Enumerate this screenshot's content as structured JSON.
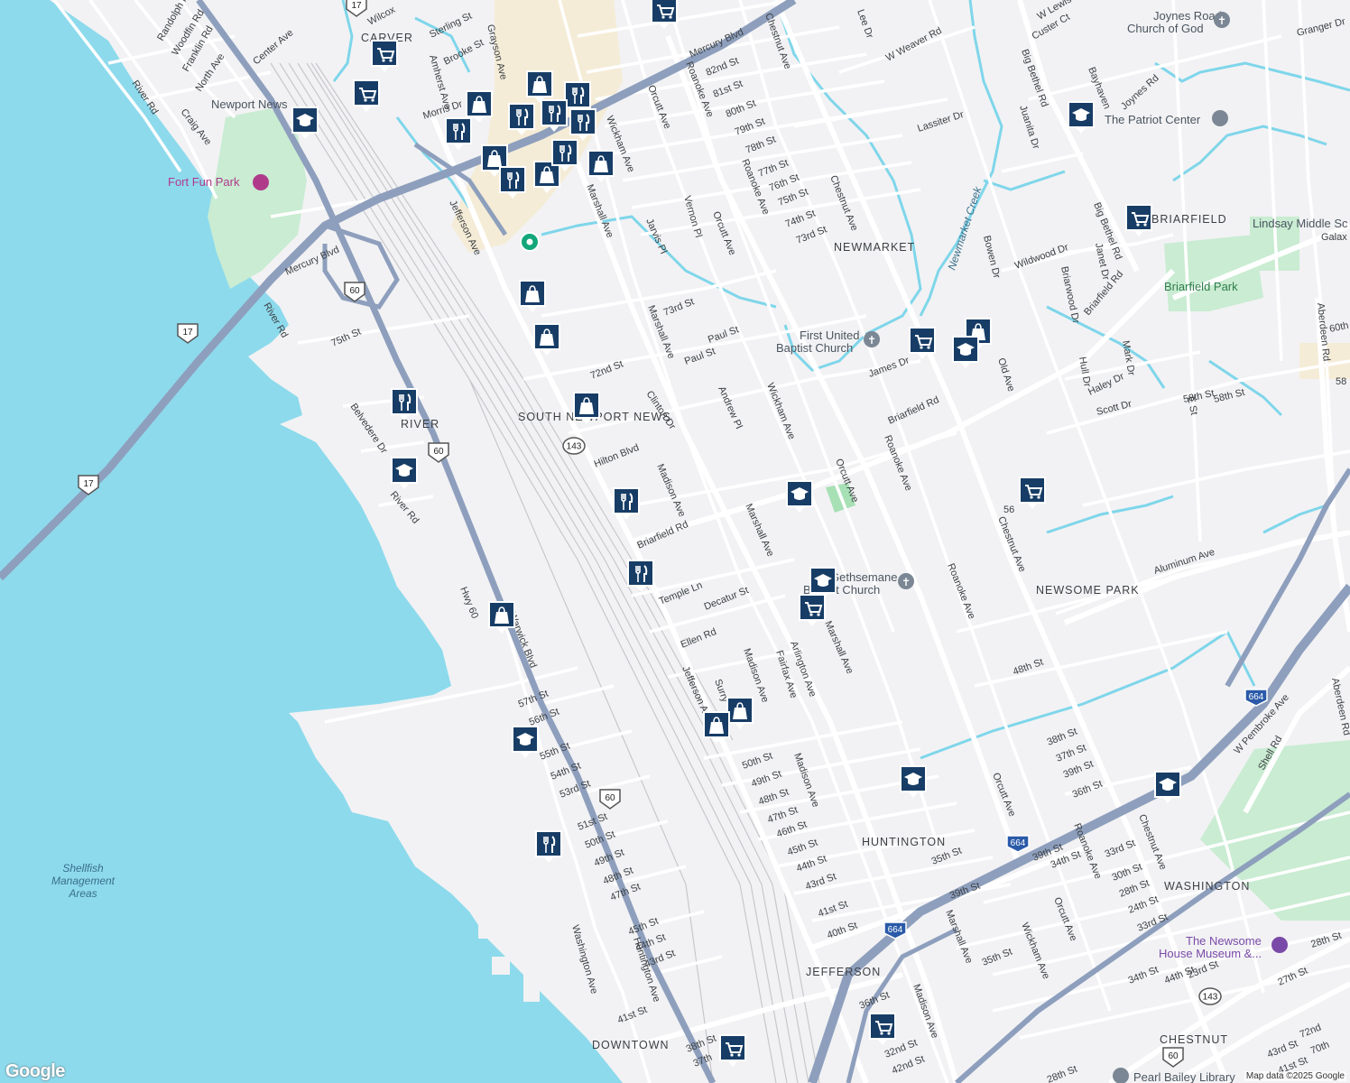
{
  "map": {
    "colors": {
      "water": "#8ddaec",
      "land": "#f2f2f4",
      "road": "#ffffff",
      "highway": "#8e9fbd",
      "park": "#c9ecd2",
      "commercial": "#f5ecd7",
      "creek": "#7fd6ea",
      "rail": "#c8c8cc",
      "pin": "#173d66"
    },
    "neighborhoods": [
      "CARVER",
      "NEWMARKET",
      "BRIARFIELD",
      "NEWSOME PARK",
      "HUNTINGTON",
      "WASHINGTON",
      "JEFFERSON",
      "DOWNTOWN",
      "CHESTNUT",
      "SOUTH NEWPORT NEWS",
      "RIVER"
    ],
    "water_labels": [
      "Shellfish",
      "Management",
      "Areas",
      "Newmarket Creek"
    ],
    "pois": [
      "Newport News",
      "Fort Fun Park",
      "First United",
      "Baptist Church",
      "Gethsemane",
      "Baptist Church",
      "Joynes Road",
      "Church of God",
      "The Patriot Center",
      "Lindsay Middle Sc",
      "Briarfield Park",
      "The Newsome",
      "House Museum &...",
      "Pearl Bailey Library",
      "Galax St"
    ],
    "streets": [
      "Mercury Blvd",
      "Jefferson Ave",
      "Marshall Ave",
      "Roanoke Ave",
      "Chestnut Ave",
      "Wickham Ave",
      "Orcutt Ave",
      "Big Bethel Rd",
      "Briarfield Rd",
      "Huntington Ave",
      "Warwick Blvd",
      "Hwy 60",
      "River Rd",
      "Aluminum Ave",
      "W Pembroke Ave",
      "Aberdeen Rd",
      "39th St",
      "28th St",
      "27th St",
      "48th St",
      "58th St",
      "72nd St",
      "73rd St",
      "75th St",
      "Hilton Blvd",
      "Clinton Dr",
      "Madison Ave",
      "Andrew Pl",
      "Paul St",
      "Temple Ln",
      "Decatur St",
      "Ellen Rd",
      "Arlington Ave",
      "Fairfax Ave",
      "Jarvis Pl",
      "Vernon Pl",
      "Lassiter Dr",
      "W Weaver Rd",
      "Joynes Rd",
      "Custer Ct",
      "Bayhaven",
      "Juanita Dr",
      "Wildwood Dr",
      "Briarwood Dr",
      "Janet Dr",
      "Bowen Dr",
      "Mark Dr",
      "Haley Dr",
      "Scott Dr",
      "Hull Dr",
      "Old Ave",
      "James Dr",
      "E St",
      "Shell Rd",
      "Washington Ave",
      "Belvedere Dr",
      "Center Ave",
      "North Ave",
      "Franklin Rd",
      "Woodfin Rd",
      "Randolph Rd",
      "Craig Ave",
      "River Rd",
      "Sterling St",
      "Brooke St",
      "Grayson Ave",
      "Amherst Ave",
      "Morris Dr",
      "Wilcox",
      "Granger Dr",
      "W Lewis Rd",
      "Lee Dr",
      "Surry"
    ],
    "numbered_streets": [
      "82nd St",
      "81st St",
      "80th St",
      "79th St",
      "78th St",
      "77th St",
      "76th St",
      "75th St",
      "74th St",
      "73rd St",
      "60th",
      "58th St",
      "58",
      "56",
      "50th St",
      "49th St",
      "48th St",
      "47th St",
      "46th St",
      "45th St",
      "44th St",
      "43rd St",
      "41st St",
      "40th St",
      "57th St",
      "56th St",
      "55th St",
      "54th St",
      "53rd St",
      "51st St",
      "50th St",
      "49th St",
      "48th St",
      "47th St",
      "45th St",
      "44th St",
      "43rd St",
      "41st St",
      "38th St",
      "37th",
      "36th St",
      "35th St",
      "34th St",
      "33rd St",
      "32nd St",
      "42nd St",
      "44th St",
      "43rd St",
      "41st St",
      "39th St",
      "38th St",
      "37th St",
      "36th St",
      "35th St",
      "34th St",
      "33rd St",
      "30th St",
      "28th St",
      "24th St",
      "23rd St",
      "72nd",
      "70th"
    ],
    "route_shields": [
      "17",
      "60",
      "143",
      "664"
    ],
    "logo": "Google",
    "attribution": "Map data ©2025 Google"
  }
}
